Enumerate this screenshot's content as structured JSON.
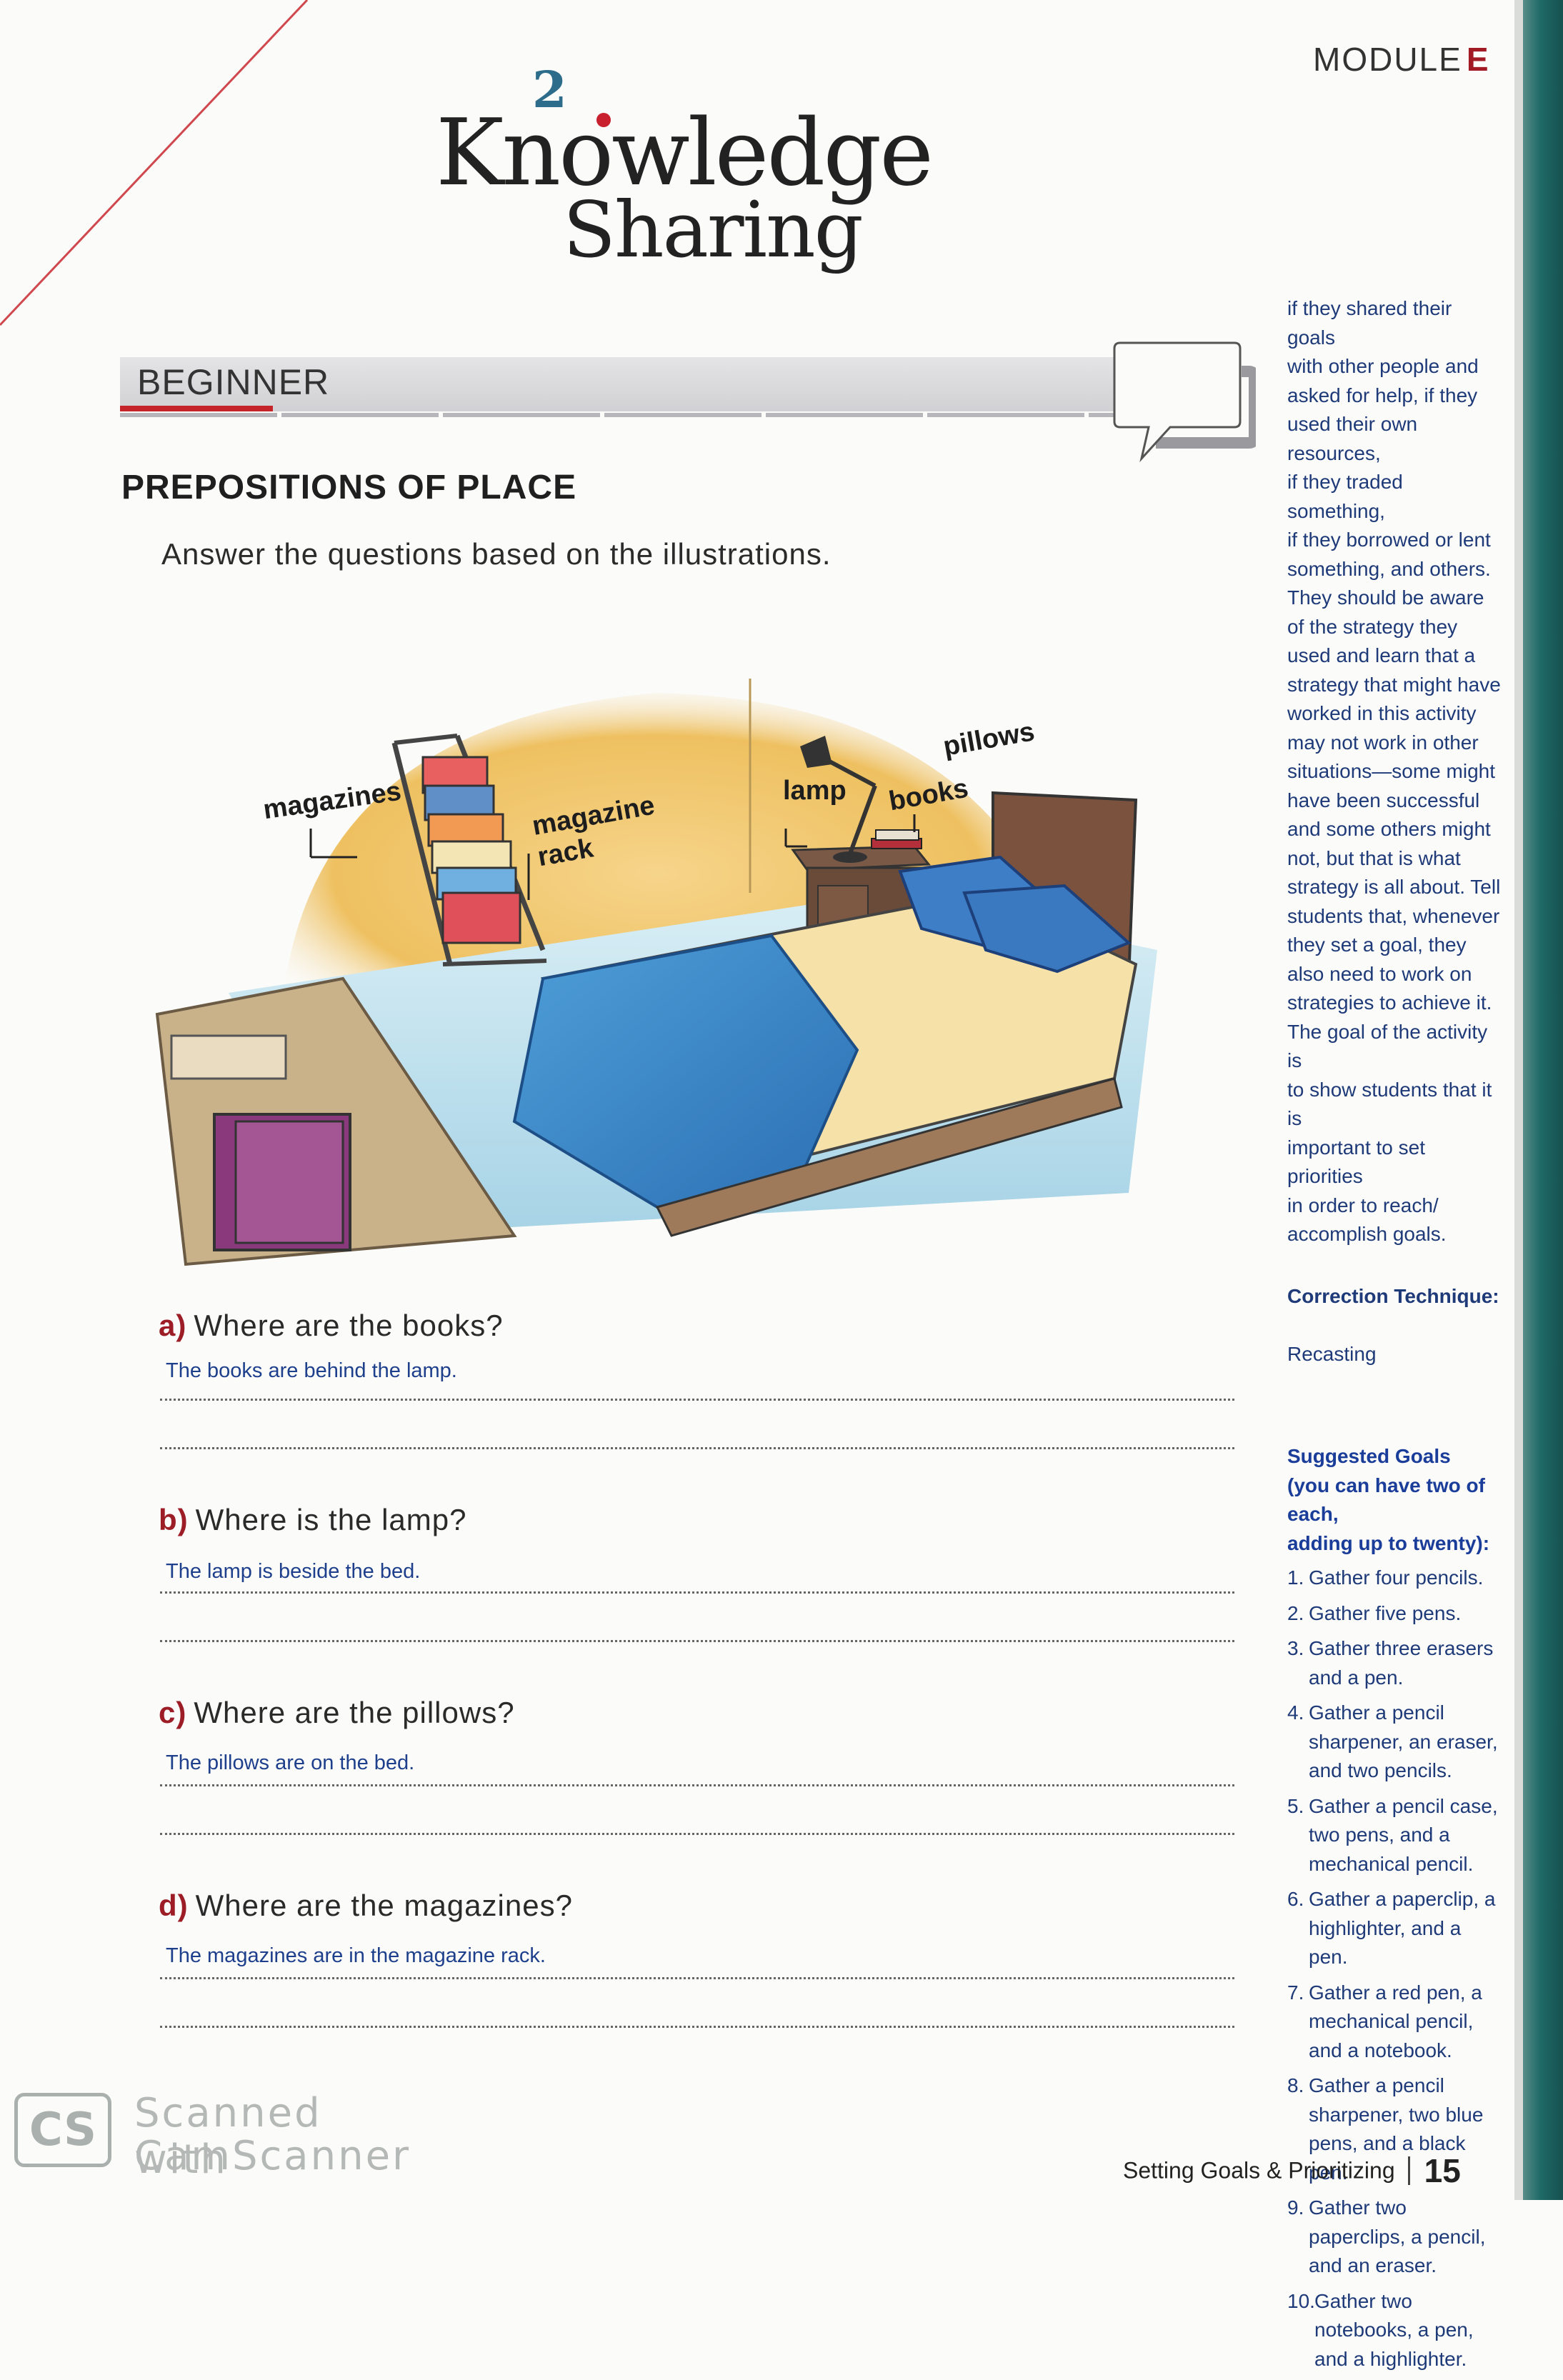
{
  "header": {
    "module_word": "MODULE",
    "module_letter": "E",
    "logo_number": "2",
    "logo_line1": "Knowledge",
    "logo_line2": "Sharing"
  },
  "level_label": "BEGINNER",
  "section_title": "PREPOSITIONS OF PLACE",
  "instructions": "Answer the questions based on the illustrations.",
  "illustration": {
    "labels": {
      "magazines": "magazines",
      "magazine_rack": "magazine\nrack",
      "lamp": "lamp",
      "books": "books",
      "pillows": "pillows"
    }
  },
  "questions": [
    {
      "letter": "a)",
      "text": "Where are the books?",
      "answer": "The books are behind the lamp."
    },
    {
      "letter": "b)",
      "text": "Where is the lamp?",
      "answer": "The lamp is beside the bed."
    },
    {
      "letter": "c)",
      "text": "Where are the pillows?",
      "answer": "The pillows are on the bed."
    },
    {
      "letter": "d)",
      "text": "Where are the magazines?",
      "answer": "The magazines are in the magazine rack."
    }
  ],
  "sidebar": {
    "paragraph": "if they shared their goals\nwith other people and\nasked for help, if they\nused their own resources,\nif they traded something,\nif they borrowed or lent\nsomething, and others.\nThey should be aware\nof the strategy they\nused and learn that a\nstrategy that might have\nworked in this activity\nmay not work in other\nsituations—some might\nhave been successful\nand some others might\nnot, but that is what\nstrategy is all about. Tell\nstudents that, whenever\nthey set a goal, they\nalso need to work on\nstrategies to achieve it.\nThe goal of the activity is\nto show students that it is\nimportant to set priorities\nin order to reach/\naccomplish goals.",
    "correction_label": "Correction Technique:",
    "correction_value": "Recasting",
    "goals_heading": "Suggested Goals",
    "goals_subheading": "(you can have two of each,\nadding up to twenty):",
    "goals": [
      {
        "num": "1.",
        "text": "Gather four pencils."
      },
      {
        "num": "2.",
        "text": "Gather five pens."
      },
      {
        "num": "3.",
        "text": "Gather three erasers\nand a pen."
      },
      {
        "num": "4.",
        "text": "Gather a pencil\nsharpener, an eraser,\nand two pencils."
      },
      {
        "num": "5.",
        "text": "Gather a pencil case,\ntwo pens, and a\nmechanical pencil."
      },
      {
        "num": "6.",
        "text": "Gather a paperclip, a\nhighlighter, and a pen."
      },
      {
        "num": "7.",
        "text": "Gather a red pen, a\nmechanical pencil,\nand a notebook."
      },
      {
        "num": "8.",
        "text": "Gather a pencil\nsharpener, two blue\npens, and a black pen."
      },
      {
        "num": "9.",
        "text": "Gather two\npaperclips, a pencil,\nand an eraser."
      },
      {
        "num": "10.",
        "text": "Gather two\nnotebooks, a pen,\nand a highlighter."
      }
    ]
  },
  "watermark": {
    "logo": "CS",
    "line1": "Scanned with",
    "line2": "CamScanner"
  },
  "footer": {
    "chapter": "Setting Goals & Prioritizing",
    "page": "15"
  },
  "colors": {
    "accent_red": "#a11a24",
    "answer_blue": "#1d3f8c",
    "teal_edge": "#1f6a67"
  }
}
